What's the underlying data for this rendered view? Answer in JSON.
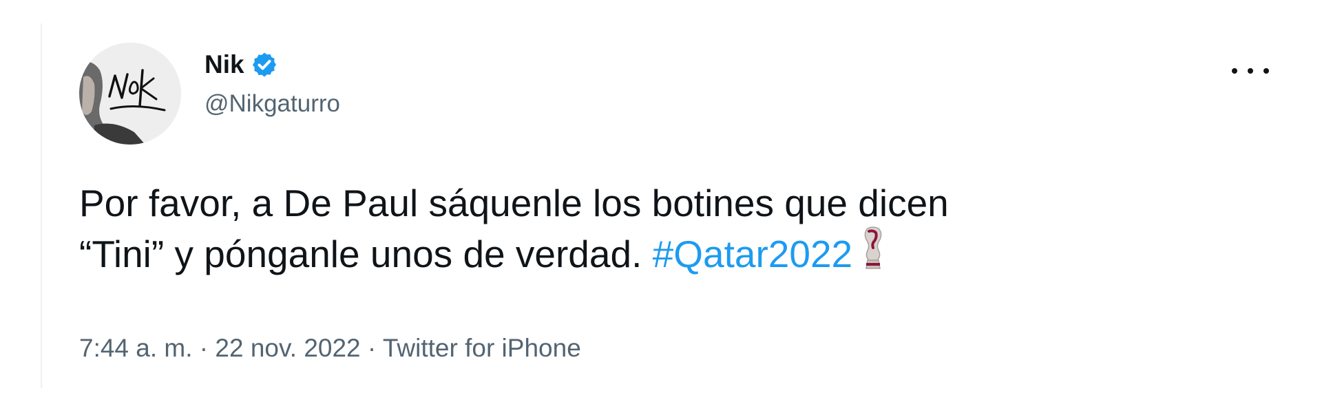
{
  "tweet": {
    "author": {
      "name": "Nik",
      "handle": "@Nikgaturro",
      "verified": true,
      "avatar_signature": "Nik"
    },
    "more_menu_icon": "more-horizontal-icon",
    "text": {
      "line1": "Por favor, a De Paul sáquenle los botines que dicen",
      "line2_prefix": "“Tini” y pónganle unos de verdad.",
      "hashtag": "#Qatar2022"
    },
    "emoji_icon": "world-cup-trophy-icon",
    "meta": {
      "time": "7:44 a. m.",
      "separator": " · ",
      "date": "22 nov. 2022",
      "source": "Twitter for iPhone"
    },
    "colors": {
      "text": "#0f1419",
      "secondary": "#536471",
      "link": "#1d9bf0",
      "verified": "#1d9bf0"
    }
  }
}
